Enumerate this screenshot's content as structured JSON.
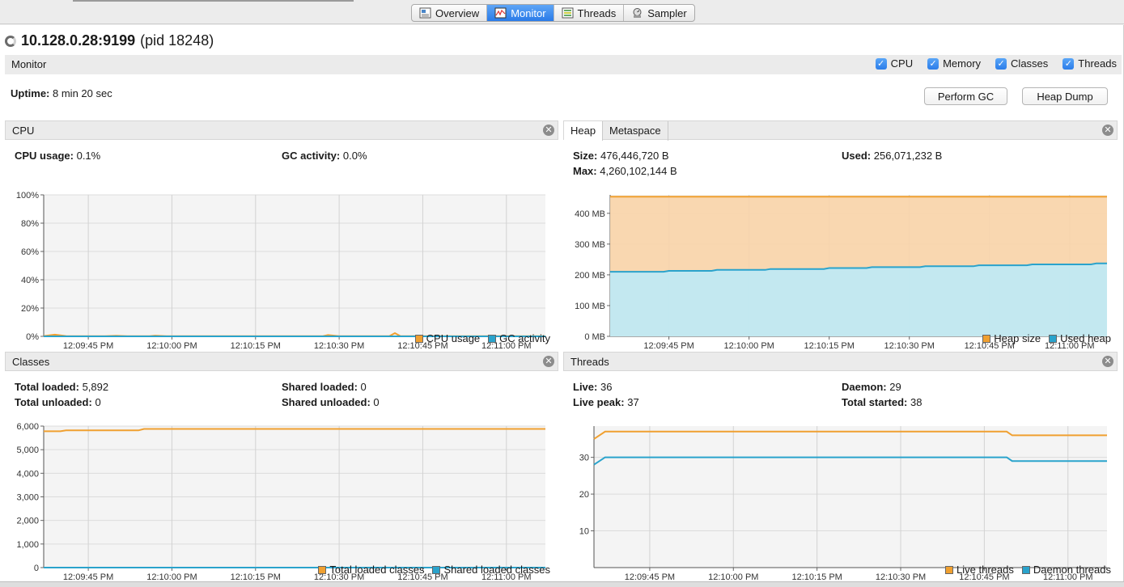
{
  "tabs": [
    {
      "label": "Overview",
      "icon": "overview-icon"
    },
    {
      "label": "Monitor",
      "icon": "monitor-icon"
    },
    {
      "label": "Threads",
      "icon": "threads-icon"
    },
    {
      "label": "Sampler",
      "icon": "sampler-icon"
    }
  ],
  "active_tab": "Monitor",
  "header": {
    "host": "10.128.0.28:9199",
    "pid": "(pid 18248)"
  },
  "monitor": {
    "label": "Monitor",
    "checks": [
      "CPU",
      "Memory",
      "Classes",
      "Threads"
    ],
    "uptime_label": "Uptime:",
    "uptime_value": "8 min 20 sec",
    "perform_gc": "Perform GC",
    "heap_dump": "Heap Dump"
  },
  "colors": {
    "orange": "#f0a030",
    "blue": "#2aa3cc",
    "orange_fill": "#f9d4a8",
    "blue_fill": "#bdeaf7"
  },
  "cpu": {
    "title": "CPU",
    "usage_label": "CPU usage:",
    "usage_value": "0.1%",
    "gc_label": "GC activity:",
    "gc_value": "0.0%",
    "legend": [
      "CPU usage",
      "GC activity"
    ]
  },
  "memory": {
    "tabs": [
      "Heap",
      "Metaspace"
    ],
    "size_label": "Size:",
    "size_value": "476,446,720 B",
    "max_label": "Max:",
    "max_value": "4,260,102,144 B",
    "used_label": "Used:",
    "used_value": "256,071,232 B",
    "legend": [
      "Heap size",
      "Used heap"
    ]
  },
  "classes": {
    "title": "Classes",
    "total_loaded_label": "Total loaded:",
    "total_loaded_value": "5,892",
    "total_unloaded_label": "Total unloaded:",
    "total_unloaded_value": "0",
    "shared_loaded_label": "Shared loaded:",
    "shared_loaded_value": "0",
    "shared_unloaded_label": "Shared unloaded:",
    "shared_unloaded_value": "0",
    "legend": [
      "Total loaded classes",
      "Shared loaded classes"
    ]
  },
  "threads": {
    "title": "Threads",
    "live_label": "Live:",
    "live_value": "36",
    "daemon_label": "Daemon:",
    "daemon_value": "29",
    "peak_label": "Live peak:",
    "peak_value": "37",
    "started_label": "Total started:",
    "started_value": "38",
    "legend": [
      "Live threads",
      "Daemon threads"
    ]
  },
  "chart_data": [
    {
      "type": "line",
      "id": "cpu",
      "xticks": [
        "12:09:45 PM",
        "12:10:00 PM",
        "12:10:15 PM",
        "12:10:30 PM",
        "12:10:45 PM",
        "12:11:00 PM"
      ],
      "xrange": [
        "12:09:37 PM",
        "12:11:07 PM"
      ],
      "yticks": [
        "0%",
        "20%",
        "40%",
        "60%",
        "80%",
        "100%"
      ],
      "ylim": [
        0,
        100
      ],
      "grid": true,
      "legend_position": "bottom-right",
      "series": [
        {
          "name": "CPU usage",
          "x": [
            "12:09:37 PM",
            "12:09:39 PM",
            "12:09:41 PM",
            "12:09:48 PM",
            "12:09:50 PM",
            "12:09:52 PM",
            "12:09:56 PM",
            "12:09:57 PM",
            "12:09:59 PM",
            "12:10:27 PM",
            "12:10:28 PM",
            "12:10:30 PM",
            "12:10:39 PM",
            "12:10:40 PM",
            "12:10:41 PM",
            "12:11:07 PM"
          ],
          "values": [
            0.2,
            1.2,
            0.2,
            0.1,
            0.4,
            0.1,
            0.1,
            0.5,
            0.1,
            0.1,
            0.9,
            0.1,
            0.1,
            2.3,
            0.1,
            0.1
          ]
        },
        {
          "name": "GC activity",
          "x": [
            "12:09:37 PM",
            "12:11:07 PM"
          ],
          "values": [
            0,
            0
          ]
        }
      ]
    },
    {
      "type": "area",
      "id": "heap",
      "xticks": [
        "12:09:45 PM",
        "12:10:00 PM",
        "12:10:15 PM",
        "12:10:30 PM",
        "12:10:45 PM",
        "12:11:00 PM"
      ],
      "xrange": [
        "12:09:34 PM",
        "12:11:07 PM"
      ],
      "yticks": [
        "0 MB",
        "100 MB",
        "200 MB",
        "300 MB",
        "400 MB"
      ],
      "ylim": [
        0,
        460
      ],
      "grid": true,
      "legend_position": "bottom-right",
      "series": [
        {
          "name": "Heap size",
          "x": [
            "12:09:34 PM",
            "12:11:07 PM"
          ],
          "values": [
            454,
            454
          ]
        },
        {
          "name": "Used heap",
          "x": [
            "12:09:34 PM",
            "12:09:44 PM",
            "12:09:45 PM",
            "12:09:53 PM",
            "12:09:54 PM",
            "12:10:03 PM",
            "12:10:04 PM",
            "12:10:14 PM",
            "12:10:15 PM",
            "12:10:22 PM",
            "12:10:23 PM",
            "12:10:32 PM",
            "12:10:33 PM",
            "12:10:42 PM",
            "12:10:43 PM",
            "12:10:52 PM",
            "12:10:53 PM",
            "12:11:04 PM",
            "12:11:05 PM",
            "12:11:07 PM"
          ],
          "values": [
            210,
            210,
            213,
            213,
            216,
            216,
            219,
            219,
            222,
            222,
            225,
            225,
            228,
            228,
            231,
            231,
            234,
            234,
            237,
            237
          ]
        }
      ]
    },
    {
      "type": "line",
      "id": "classes",
      "xticks": [
        "12:09:45 PM",
        "12:10:00 PM",
        "12:10:15 PM",
        "12:10:30 PM",
        "12:10:45 PM",
        "12:11:00 PM"
      ],
      "xrange": [
        "12:09:37 PM",
        "12:11:07 PM"
      ],
      "yticks": [
        "0",
        "1,000",
        "2,000",
        "3,000",
        "4,000",
        "5,000",
        "6,000"
      ],
      "ylim": [
        0,
        6000
      ],
      "grid": true,
      "legend_position": "bottom-right",
      "series": [
        {
          "name": "Total loaded classes",
          "x": [
            "12:09:37 PM",
            "12:09:40 PM",
            "12:09:41 PM",
            "12:09:54 PM",
            "12:09:55 PM",
            "12:11:07 PM"
          ],
          "values": [
            5780,
            5780,
            5820,
            5820,
            5880,
            5880
          ]
        },
        {
          "name": "Shared loaded classes",
          "x": [
            "12:09:37 PM",
            "12:11:07 PM"
          ],
          "values": [
            0,
            0
          ]
        }
      ]
    },
    {
      "type": "line",
      "id": "threads",
      "xticks": [
        "12:09:45 PM",
        "12:10:00 PM",
        "12:10:15 PM",
        "12:10:30 PM",
        "12:10:45 PM",
        "12:11:00 PM"
      ],
      "xrange": [
        "12:09:35 PM",
        "12:11:07 PM"
      ],
      "yticks": [
        "10",
        "20",
        "30"
      ],
      "ylim": [
        0,
        38.5
      ],
      "grid": true,
      "legend_position": "bottom-right",
      "series": [
        {
          "name": "Live threads",
          "x": [
            "12:09:35 PM",
            "12:09:37 PM",
            "12:10:49 PM",
            "12:10:50 PM",
            "12:11:07 PM"
          ],
          "values": [
            35,
            37,
            37,
            36,
            36
          ]
        },
        {
          "name": "Daemon threads",
          "x": [
            "12:09:35 PM",
            "12:09:37 PM",
            "12:10:49 PM",
            "12:10:50 PM",
            "12:11:07 PM"
          ],
          "values": [
            28,
            30,
            30,
            29,
            29
          ]
        }
      ]
    }
  ]
}
